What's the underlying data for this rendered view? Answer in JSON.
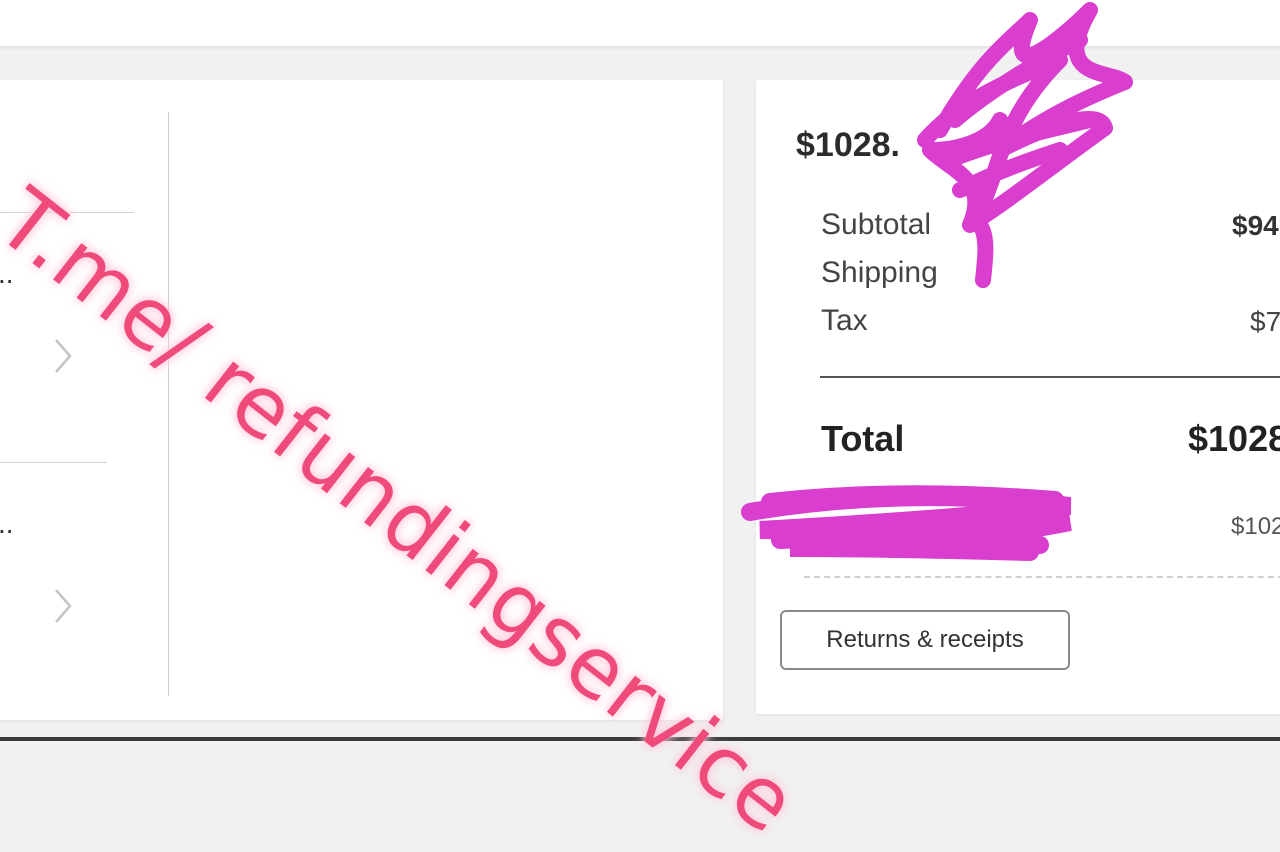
{
  "order_summary": {
    "header_amount": "$1028.",
    "lines": [
      {
        "label": "Subtotal",
        "value": "$94"
      },
      {
        "label": "Shipping",
        "value": ""
      },
      {
        "label": "Tax",
        "value": "$7"
      }
    ],
    "total_label": "Total",
    "total_value": "$1028",
    "paid_value": "$102",
    "returns_button_label": "Returns & receipts"
  },
  "left_panel": {
    "row_1_ellipsis": "..",
    "row_2_ellipsis": ".."
  },
  "watermark_text": "T.me/ refundingservice",
  "colors": {
    "redaction_scribble": "#d93ecf",
    "watermark": "#ee4a7a",
    "page_background": "#f1f1f1"
  },
  "icons": [
    "chevron-right-icon",
    "chevron-right-icon"
  ]
}
